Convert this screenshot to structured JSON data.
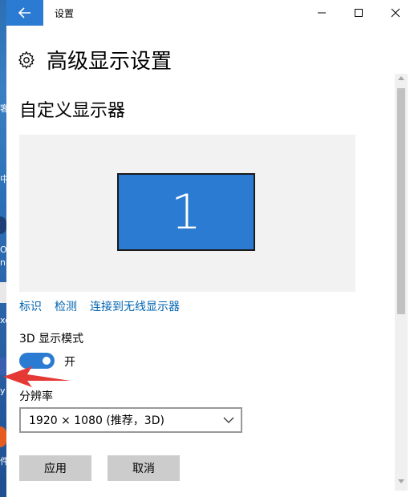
{
  "window": {
    "title": "设置",
    "back_icon": "arrow-left-icon",
    "minimize_icon": "minimize-icon",
    "maximize_icon": "maximize-icon",
    "close_icon": "close-icon",
    "accent_color": "#2b7bd2"
  },
  "header": {
    "icon": "gear-icon",
    "title": "高级显示设置"
  },
  "section": {
    "title": "自定义显示器"
  },
  "display": {
    "monitor_number": "1",
    "monitor_color": "#2b7bd2"
  },
  "links": {
    "identify": "标识",
    "detect": "检测",
    "connect_wireless": "连接到无线显示器"
  },
  "stereo_mode": {
    "label": "3D 显示模式",
    "state_label": "开",
    "enabled": true
  },
  "resolution": {
    "label": "分辨率",
    "selected": "1920 × 1080 (推荐，3D)"
  },
  "buttons": {
    "apply": "应用",
    "cancel": "取消"
  },
  "desktop": {
    "fragments": [
      "客",
      "中",
      "O",
      "n",
      "xe",
      "y",
      "件"
    ]
  },
  "annotation": {
    "arrow_color": "#e53935"
  }
}
